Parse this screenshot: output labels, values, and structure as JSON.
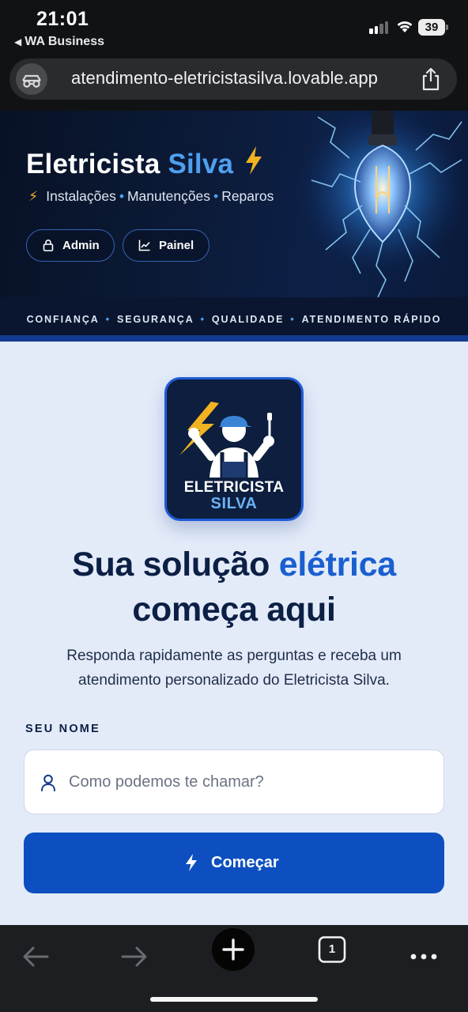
{
  "status_bar": {
    "time": "21:01",
    "back_app": "WA Business",
    "battery": "39",
    "icons": [
      "signal-icon",
      "wifi-icon",
      "battery-icon"
    ]
  },
  "browser": {
    "url": "atendimento-eletricistasilva.lovable.app",
    "lead_icon": "site-settings-icon",
    "share_icon": "share-icon",
    "toolbar": {
      "back_icon": "arrow-left-icon",
      "forward_icon": "arrow-right-icon",
      "new_tab_icon": "plus-icon",
      "tab_count": "1",
      "more_icon": "more-dots-icon"
    }
  },
  "hero": {
    "brand_main": "Eletricista",
    "brand_accent": "Silva",
    "tagline": [
      "Instalações",
      "Manutenções",
      "Reparos"
    ],
    "buttons": {
      "admin": "Admin",
      "painel": "Painel"
    },
    "values": [
      "CONFIANÇA",
      "SEGURANÇA",
      "QUALIDADE",
      "ATENDIMENTO RÁPIDO"
    ]
  },
  "logo": {
    "line1": "ELETRICISTA",
    "line2": "SILVA"
  },
  "main": {
    "headline_part1": "Sua solução",
    "headline_accent": "elétrica",
    "headline_part2": "começa aqui",
    "subtitle": "Responda rapidamente as perguntas e receba um atendimento personalizado do Eletricista Silva.",
    "name_label": "SEU NOME",
    "name_placeholder": "Como podemos te chamar?",
    "name_value": "",
    "start_button": "Começar"
  },
  "colors": {
    "accent": "#1a5fd0",
    "brand_blue": "#4ea0f0",
    "navy": "#0c1f45",
    "bolt_yellow": "#f2b320",
    "button": "#0d4fc0",
    "page_bg": "#e3ebf9"
  }
}
